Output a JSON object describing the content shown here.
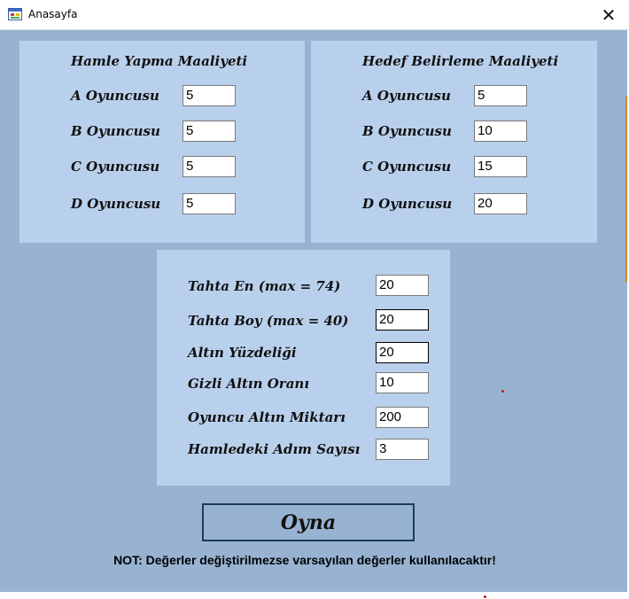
{
  "window": {
    "title": "Anasayfa",
    "close_glyph": "✕",
    "icon": "app-form-icon"
  },
  "move_cost": {
    "title": "Hamle Yapma Maaliyeti",
    "rows": [
      {
        "label": "A Oyuncusu",
        "value": "5"
      },
      {
        "label": "B Oyuncusu",
        "value": "5"
      },
      {
        "label": "C Oyuncusu",
        "value": "5"
      },
      {
        "label": "D Oyuncusu",
        "value": "5"
      }
    ]
  },
  "target_cost": {
    "title": "Hedef Belirleme Maaliyeti",
    "rows": [
      {
        "label": "A Oyuncusu",
        "value": "5"
      },
      {
        "label": "B Oyuncusu",
        "value": "10"
      },
      {
        "label": "C Oyuncusu",
        "value": "15"
      },
      {
        "label": "D Oyuncusu",
        "value": "20"
      }
    ]
  },
  "settings": {
    "rows": [
      {
        "label": "Tahta En (max = 74)",
        "value": "20"
      },
      {
        "label": "Tahta Boy (max = 40)",
        "value": "20"
      },
      {
        "label": "Altın Yüzdeliği",
        "value": "20"
      },
      {
        "label": "Gizli Altın Oranı",
        "value": "10"
      },
      {
        "label": "Oyuncu Altın Miktarı",
        "value": "200"
      },
      {
        "label": "Hamledeki Adım Sayısı",
        "value": "3"
      }
    ]
  },
  "play_button": {
    "label": "Oyna"
  },
  "note": "NOT: Değerler değiştirilmezse varsayılan değerler kullanılacaktır!",
  "colors": {
    "client_bg": "#97b3d1",
    "panel_bg": "#b9d0ec",
    "button_border": "#1e3a5f"
  }
}
